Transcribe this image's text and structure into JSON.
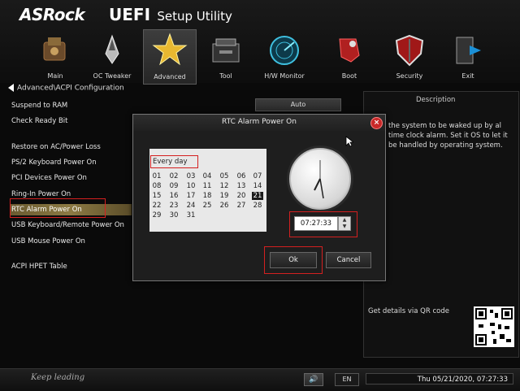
{
  "header": {
    "brand": "ASRock",
    "product_bold": "UEFI",
    "product_rest": "Setup Utility"
  },
  "nav": [
    {
      "label": "Main",
      "icon": "main-icon"
    },
    {
      "label": "OC Tweaker",
      "icon": "rocket-icon"
    },
    {
      "label": "Advanced",
      "icon": "star-icon",
      "active": true
    },
    {
      "label": "Tool",
      "icon": "toolbox-icon"
    },
    {
      "label": "H/W Monitor",
      "icon": "radar-icon"
    },
    {
      "label": "Boot",
      "icon": "boot-icon"
    },
    {
      "label": "Security",
      "icon": "shield-icon"
    },
    {
      "label": "Exit",
      "icon": "exit-icon"
    }
  ],
  "breadcrumb": "Advanced\\ACPI Configuration",
  "menu": [
    "Suspend to RAM",
    "Check Ready Bit",
    "Restore on AC/Power Loss",
    "PS/2 Keyboard Power On",
    "PCI Devices Power On",
    "Ring-In Power On",
    "RTC Alarm Power On",
    "USB Keyboard/Remote Power On",
    "USB Mouse Power On",
    "ACPI HPET Table"
  ],
  "option_value": "Auto",
  "description": {
    "title": "Description",
    "text": "the system to be waked up by al time clock alarm. Set it OS to let it be handled by operating system."
  },
  "qr_label": "Get details via QR code",
  "dialog": {
    "title": "RTC Alarm Power On",
    "calendar_header": "Every day",
    "days": [
      "01",
      "02",
      "03",
      "04",
      "05",
      "06",
      "07",
      "08",
      "09",
      "10",
      "11",
      "12",
      "13",
      "14",
      "15",
      "16",
      "17",
      "18",
      "19",
      "20",
      "21",
      "22",
      "23",
      "24",
      "25",
      "26",
      "27",
      "28",
      "29",
      "30",
      "31"
    ],
    "selected_day": "21",
    "time": "07:27:33",
    "ok_label": "Ok",
    "cancel_label": "Cancel"
  },
  "footer": {
    "tagline": "Keep leading",
    "language": "EN",
    "datetime": "Thu 05/21/2020, 07:27:33"
  },
  "colors": {
    "highlight_red": "#d42020",
    "selection_gold": "#8c7a44",
    "close_red": "#c82828"
  }
}
